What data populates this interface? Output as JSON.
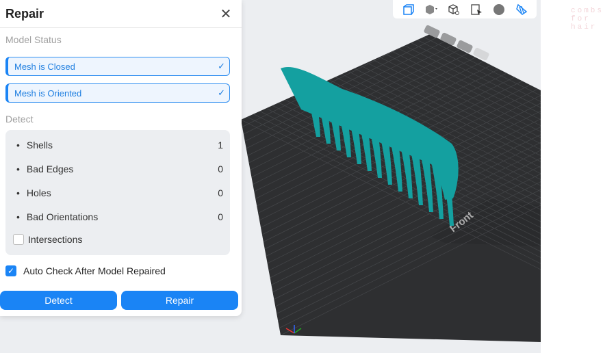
{
  "panel": {
    "title": "Repair",
    "close_icon": "close-icon",
    "model_status_label": "Model Status",
    "status": [
      {
        "label": "Mesh is Closed"
      },
      {
        "label": "Mesh is Oriented"
      }
    ],
    "detect_label": "Detect",
    "detect_items": [
      {
        "label": "Shells",
        "value": "1"
      },
      {
        "label": "Bad Edges",
        "value": "0"
      },
      {
        "label": "Holes",
        "value": "0"
      },
      {
        "label": "Bad Orientations",
        "value": "0"
      }
    ],
    "intersections_label": "Intersections",
    "intersections_checked": false,
    "auto_check_label": "Auto Check After Model Repaired",
    "auto_check_checked": true,
    "detect_button": "Detect",
    "repair_button": "Repair"
  },
  "toolbar": {
    "icons": [
      "front-view-icon",
      "cube-view-icon",
      "zoom-fit-icon",
      "select-icon",
      "sphere-render-icon",
      "slice-view-icon"
    ]
  },
  "viewport": {
    "front_label": "Front",
    "accent": "#1a84f5",
    "model_color": "#14a0a0"
  },
  "watermark": "combs\nfor\nhair"
}
